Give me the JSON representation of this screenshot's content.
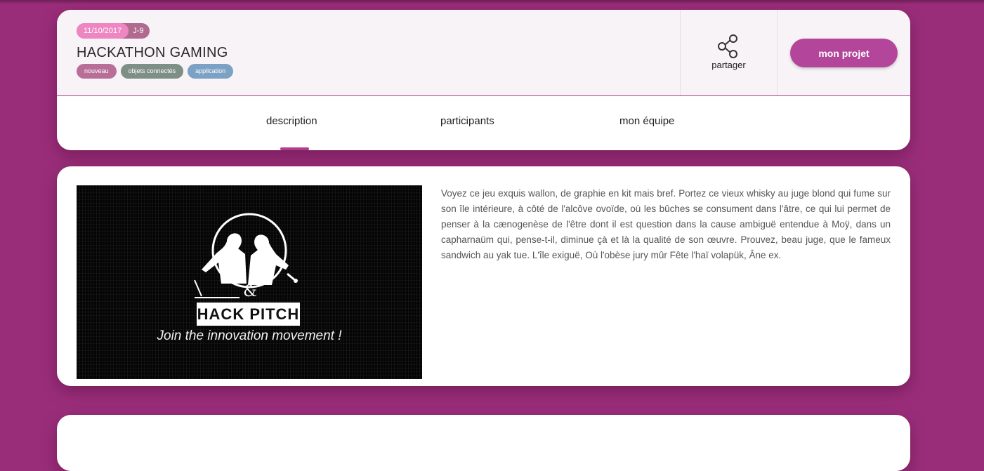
{
  "event": {
    "date": "11/10/2017",
    "countdown": "J-9",
    "title": "HACKATHON GAMING",
    "tags": [
      {
        "label": "nouveau",
        "color": "#b86e99"
      },
      {
        "label": "objets connectés",
        "color": "#7e8f86"
      },
      {
        "label": "application",
        "color": "#7ba1c4"
      }
    ]
  },
  "actions": {
    "share_label": "partager",
    "share_icon": "share-icon",
    "project_button": "mon projet"
  },
  "tabs": [
    {
      "label": "description",
      "active": true
    },
    {
      "label": "participants",
      "active": false
    },
    {
      "label": "mon équipe",
      "active": false
    }
  ],
  "hero": {
    "badge": "HACK PITCH",
    "ampersand": "&",
    "tagline": "Join the innovation movement !"
  },
  "description": "Voyez ce jeu exquis wallon, de graphie en kit mais bref. Portez ce vieux whisky au juge blond qui fume sur son île intérieure, à côté de l'alcôve ovoïde, où les bûches se consument dans l'âtre, ce qui lui permet de penser à la cænogenèse de l'être dont il est question dans la cause ambiguë entendue à Moÿ, dans un capharnaüm qui, pense-t-il, diminue çà et là la qualité de son œuvre. Prouvez, beau juge, que le fameux sandwich au yak tue. L'île exiguë, Où l'obèse jury mûr Fête l'haï volapük, Âne ex.",
  "colors": {
    "background": "#9a2d7a",
    "accent": "#b3469a",
    "date_pill": "#ee86c2"
  }
}
